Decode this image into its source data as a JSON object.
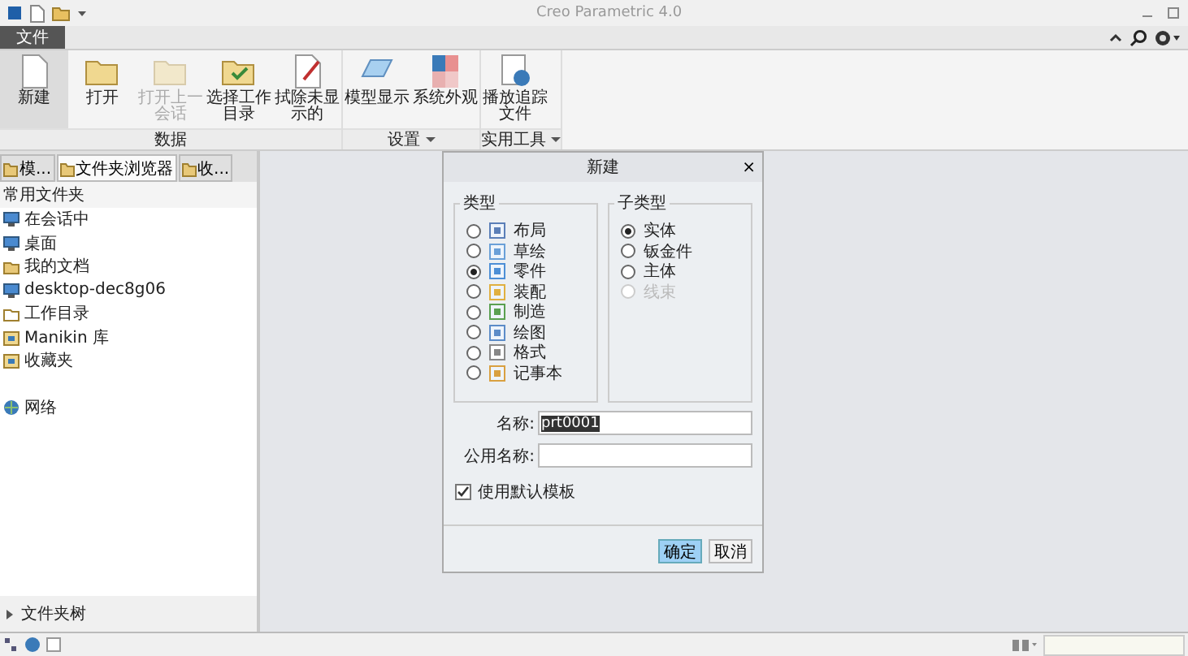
{
  "window": {
    "title": "Creo Parametric 4.0"
  },
  "ribbon_tabs": [
    {
      "label": "文件",
      "selected": true
    }
  ],
  "ribbon_groups": [
    {
      "label": "数据",
      "menu": false,
      "buttons": [
        {
          "label": "新建",
          "kind": "new",
          "disabled": false,
          "selected": true
        },
        {
          "label": "打开",
          "kind": "open",
          "disabled": false,
          "selected": false
        },
        {
          "label": "打开上一会话",
          "kind": "open",
          "disabled": true,
          "selected": false
        },
        {
          "label": "选择工作目录",
          "kind": "workdir",
          "disabled": false,
          "selected": false
        },
        {
          "label": "拭除未显示的",
          "kind": "erase",
          "disabled": false,
          "selected": false
        }
      ]
    },
    {
      "label": "设置",
      "menu": true,
      "buttons": [
        {
          "label": "模型显示",
          "kind": "display",
          "disabled": false,
          "selected": false
        },
        {
          "label": "系统外观",
          "kind": "appearance",
          "disabled": false,
          "selected": false
        }
      ]
    },
    {
      "label": "实用工具",
      "menu": true,
      "buttons": [
        {
          "label": "播放追踪文件",
          "kind": "trail",
          "disabled": false,
          "selected": false
        }
      ]
    }
  ],
  "navigator": {
    "tabs": [
      {
        "label": "模...",
        "selected": false
      },
      {
        "label": "文件夹浏览器",
        "selected": true
      },
      {
        "label": "收...",
        "selected": false
      }
    ],
    "header": "常用文件夹",
    "folder_groups": [
      [
        {
          "label": "在会话中",
          "kind": "monitor"
        },
        {
          "label": "桌面",
          "kind": "monitor"
        },
        {
          "label": "我的文档",
          "kind": "docs"
        },
        {
          "label": "desktop-dec8g06",
          "kind": "monitor"
        },
        {
          "label": "工作目录",
          "kind": "folder"
        },
        {
          "label": "Manikin 库",
          "kind": "lib"
        },
        {
          "label": "收藏夹",
          "kind": "lib"
        }
      ],
      [
        {
          "label": "网络",
          "kind": "globe"
        }
      ]
    ],
    "tree": {
      "label": "文件夹树",
      "expanded": false
    }
  },
  "dialog": {
    "title": "新建",
    "close": "×",
    "type_group": {
      "label": "类型",
      "options": [
        {
          "label": "布局",
          "kind": "layout",
          "selected": false
        },
        {
          "label": "草绘",
          "kind": "sketch",
          "selected": false
        },
        {
          "label": "零件",
          "kind": "part",
          "selected": true
        },
        {
          "label": "装配",
          "kind": "assembly",
          "selected": false
        },
        {
          "label": "制造",
          "kind": "mfg",
          "selected": false
        },
        {
          "label": "绘图",
          "kind": "drawing",
          "selected": false
        },
        {
          "label": "格式",
          "kind": "format",
          "selected": false
        },
        {
          "label": "记事本",
          "kind": "notebook",
          "selected": false
        }
      ]
    },
    "subtype_group": {
      "label": "子类型",
      "options": [
        {
          "label": "实体",
          "selected": true,
          "disabled": false
        },
        {
          "label": "钣金件",
          "selected": false,
          "disabled": false
        },
        {
          "label": "主体",
          "selected": false,
          "disabled": false
        },
        {
          "label": "线束",
          "selected": false,
          "disabled": true
        }
      ]
    },
    "name": {
      "label": "名称:",
      "value": "prt0001",
      "highlighted": true
    },
    "common_name": {
      "label": "公用名称:"
    },
    "use_template": {
      "label": "使用默认模板",
      "checked": true
    },
    "buttons": [
      {
        "label": "确定",
        "primary": true
      },
      {
        "label": "取消",
        "primary": false
      }
    ]
  }
}
